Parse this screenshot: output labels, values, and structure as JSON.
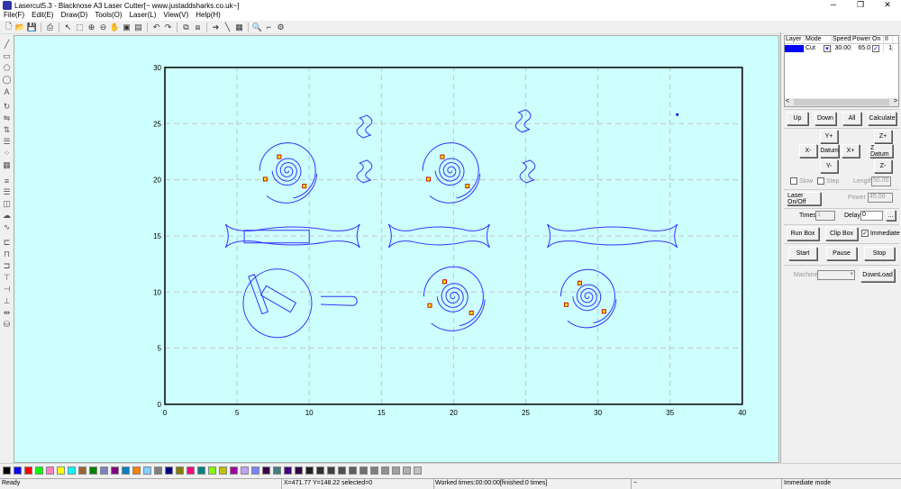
{
  "window": {
    "title": "Lasercut5.3 - Blacknose A3 Laser Cutter[~ www.justaddsharks.co.uk~]",
    "controls": [
      "─",
      "❐",
      "✕"
    ]
  },
  "menu": [
    "File(F)",
    "Edit(E)",
    "Draw(D)",
    "Tools(O)",
    "Laser(L)",
    "View(V)",
    "Help(H)"
  ],
  "toolbar": [
    "new-icon",
    "open-icon",
    "save-icon",
    "|",
    "print-icon",
    "|",
    "select-icon",
    "zoom-window-icon",
    "zoom-in-icon",
    "zoom-out-icon",
    "pan-icon",
    "zoom-fit-icon",
    "zoom-page-icon",
    "|",
    "undo-icon",
    "redo-icon",
    "|",
    "group-icon",
    "ungroup-icon",
    "|",
    "cut-path-icon",
    "node-edit-icon",
    "array-icon",
    "|",
    "preview-icon",
    "laser-settings-icon",
    "machine-icon"
  ],
  "left_tools": [
    "line-icon",
    "rectangle-icon",
    "polygon-icon",
    "ellipse-icon",
    "text-icon",
    "rotate-icon",
    "mirror-h-icon",
    "mirror-v-icon",
    "align-icon",
    "dots-icon",
    "grid-icon",
    "layers-icon",
    "stack-icon",
    "offset-icon",
    "weld-icon",
    "wave-icon",
    "align-left-icon",
    "align-center-icon",
    "align-right-icon",
    "align-top-icon",
    "align-middle-icon",
    "align-bottom-icon",
    "distribute-icon",
    "database-icon"
  ],
  "canvas": {
    "background": "#ccfffd",
    "x_ticks": [
      "0",
      "5",
      "10",
      "15",
      "20",
      "25",
      "30",
      "35",
      "40"
    ],
    "y_ticks": [
      "0",
      "5",
      "10",
      "15",
      "20",
      "25",
      "30"
    ],
    "path_color": "#3333ff"
  },
  "layer_table": {
    "headers": [
      "Layer",
      "Mode",
      "Speed",
      "Power",
      "On",
      "II"
    ],
    "rows": [
      {
        "color": "#0000ff",
        "mode": "Cut",
        "speed": "30.00",
        "power": "65.0",
        "on": true,
        "count": "1"
      }
    ]
  },
  "panel": {
    "up": "Up",
    "down": "Down",
    "all": "All",
    "calculate": "Calculate",
    "y_plus": "Y+",
    "y_minus": "Y-",
    "x_minus": "X-",
    "x_plus": "X+",
    "datum": "Datum",
    "z_plus": "Z+",
    "z_datum": "Z Datum",
    "z_minus": "Z-",
    "slow": "Slow",
    "step": "Step",
    "length_label": "Length",
    "length": "50.00",
    "laser_onoff": "Laser On/Off",
    "power_label": "Power",
    "power": "45.00",
    "times_label": "Times:",
    "times": "1",
    "delay_label": "Delay:",
    "delay": "0",
    "more": "...",
    "run_box": "Run Box",
    "clip_box": "Clip Box",
    "immediate": "Immediate",
    "immediate_checked": true,
    "start": "Start",
    "pause": "Pause",
    "stop": "Stop",
    "machine_label": "Machine",
    "machine": "",
    "download": "DownLoad"
  },
  "palette": [
    "#000000",
    "#0000ff",
    "#ff0000",
    "#00ff00",
    "#ff80c0",
    "#ffff00",
    "#00ffff",
    "#996633",
    "#008000",
    "#8080c0",
    "#800080",
    "#0080c0",
    "#ff8000",
    "#80d0ff",
    "#808080",
    "#000080",
    "#808000",
    "#ff0080",
    "#008080",
    "#80ff00",
    "#c0c000",
    "#a000a0",
    "#c0a0ff",
    "#8080ff",
    "#400040",
    "#408080",
    "#400080",
    "#300040",
    "#202020",
    "#303030",
    "#404040",
    "#505050",
    "#606060",
    "#707070",
    "#808080",
    "#909090",
    "#a0a0a0",
    "#b0b0b0",
    "#c0c0c0"
  ],
  "status": {
    "ready": "Ready",
    "coords": "X=471.77 Y=148.22 selected=0",
    "worked": "Worked times:00:00:00[finished:0 times]",
    "extra": "~",
    "mode": "Immediate mode"
  }
}
